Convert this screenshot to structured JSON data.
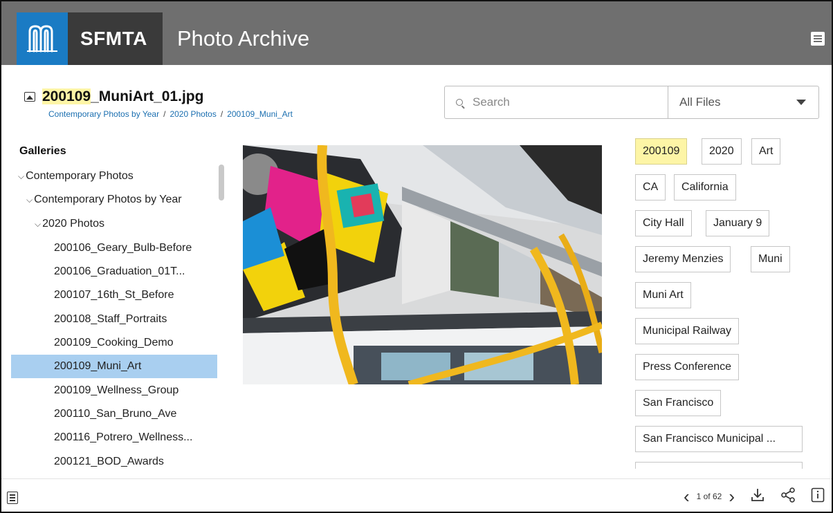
{
  "header": {
    "logo_text": "SFMTA",
    "app_title": "Photo Archive",
    "menu_icon": "menu-icon"
  },
  "file": {
    "name_highlight": "200109",
    "name_rest": "_MuniArt_01.jpg",
    "breadcrumb": [
      "Contemporary Photos by Year",
      "2020 Photos",
      "200109_Muni_Art"
    ],
    "breadcrumb_sep": "/"
  },
  "search": {
    "placeholder": "Search",
    "filter_value": "All Files"
  },
  "sidebar": {
    "title": "Galleries",
    "items": [
      {
        "label": "Contemporary Photos",
        "chevron": "⌵"
      },
      {
        "label": "Contemporary Photos by Year",
        "chevron": "⌵"
      },
      {
        "label": "2020 Photos",
        "chevron": "⌵"
      },
      {
        "label": "200106_Geary_Bulb-Before"
      },
      {
        "label": "200106_Graduation_01T..."
      },
      {
        "label": "200107_16th_St_Before"
      },
      {
        "label": "200108_Staff_Portraits"
      },
      {
        "label": "200109_Cooking_Demo"
      },
      {
        "label": "200109_Muni_Art",
        "selected": true
      },
      {
        "label": "200109_Wellness_Group"
      },
      {
        "label": "200110_San_Bruno_Ave"
      },
      {
        "label": "200116_Potrero_Wellness..."
      },
      {
        "label": "200121_BOD_Awards"
      }
    ]
  },
  "tags": [
    {
      "label": "200109",
      "highlight": true
    },
    {
      "label": "2020"
    },
    {
      "label": "Art"
    },
    {
      "label": "CA"
    },
    {
      "label": "California"
    },
    {
      "label": "City Hall"
    },
    {
      "label": "January 9"
    },
    {
      "label": "Jeremy Menzies"
    },
    {
      "label": "Muni"
    },
    {
      "label": "Muni Art"
    },
    {
      "label": "Municipal Railway"
    },
    {
      "label": "Press Conference"
    },
    {
      "label": "San Francisco"
    },
    {
      "label": "San Francisco Municipal ..."
    }
  ],
  "footer": {
    "page_text": "1 of 62",
    "prev_glyph": "‹",
    "next_glyph": "›"
  },
  "colors": {
    "header_bg": "#6f6f6f",
    "logo_blue": "#1a7bc4",
    "selected_row": "#a9cff0",
    "highlight": "#fdf5a6",
    "link": "#1b6fb0"
  }
}
